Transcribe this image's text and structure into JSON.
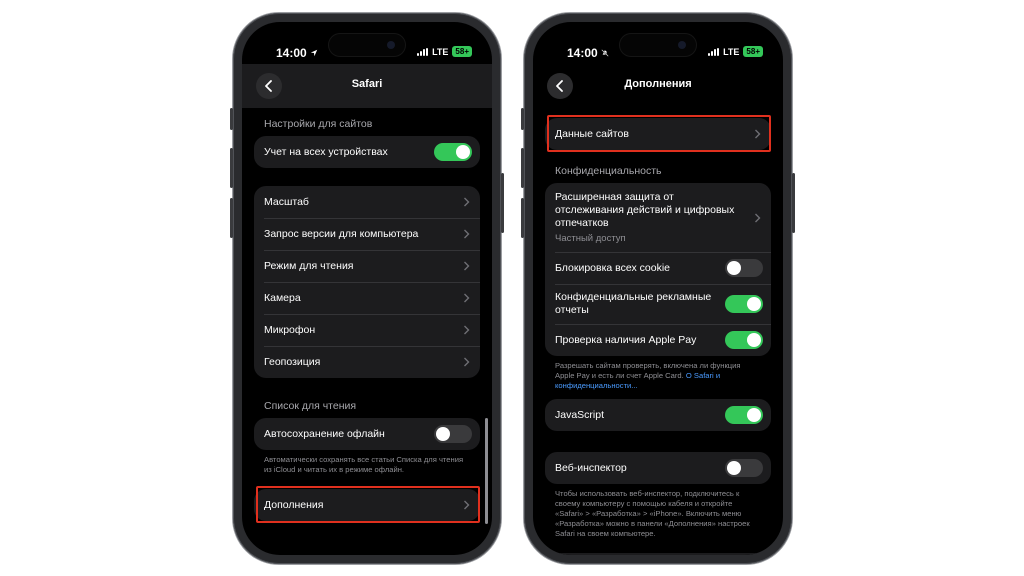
{
  "left_phone": {
    "status": {
      "time": "14:00",
      "network": "LTE",
      "battery": "58+"
    },
    "nav": {
      "title": "Safari"
    },
    "site_settings": {
      "header": "Настройки для сайтов",
      "sync_row": {
        "label": "Учет на всех устройствах",
        "toggle": "on"
      }
    },
    "site_items": [
      {
        "label": "Масштаб"
      },
      {
        "label": "Запрос версии для компьютера"
      },
      {
        "label": "Режим для чтения"
      },
      {
        "label": "Камера"
      },
      {
        "label": "Микрофон"
      },
      {
        "label": "Геопозиция"
      }
    ],
    "reading_list": {
      "header": "Список для чтения",
      "autosave_label": "Автосохранение офлайн",
      "autosave_toggle": "off",
      "footnote": "Автоматически сохранять все статьи Списка для чтения из iCloud и читать их в режиме офлайн."
    },
    "advanced": {
      "label": "Дополнения"
    }
  },
  "right_phone": {
    "status": {
      "time": "14:00",
      "network": "LTE",
      "battery": "58+"
    },
    "nav": {
      "title": "Дополнения"
    },
    "website_data": {
      "label": "Данные сайтов"
    },
    "privacy": {
      "header": "Конфиденциальность",
      "tracking_label": "Расширенная защита от отслеживания действий и цифровых отпечатков",
      "tracking_value": "Частный доступ",
      "block_cookies_label": "Блокировка всех cookie",
      "block_cookies_toggle": "off",
      "ad_reports_label": "Конфиденциальные рекламные отчеты",
      "ad_reports_toggle": "on",
      "apple_pay_label": "Проверка наличия Apple Pay",
      "apple_pay_toggle": "on",
      "footnote": "Разрешать сайтам проверять, включена ли функция Apple Pay и есть ли счет Apple Card.",
      "footnote_link": "О Safari и конфиденциальности..."
    },
    "javascript": {
      "label": "JavaScript",
      "toggle": "on"
    },
    "web_inspector": {
      "label": "Веб-инспектор",
      "toggle": "off",
      "footnote": "Чтобы использовать веб-инспектор, подключитесь к своему компьютеру с помощью кабеля и откройте «Safari» > «Разработка» > «iPhone». Включить меню «Разработка» можно в панели «Дополнения» настроек Safari на своем компьютере."
    }
  },
  "colors": {
    "highlight": "#e0301e",
    "toggle_on": "#34c759",
    "link": "#4a9bff"
  }
}
